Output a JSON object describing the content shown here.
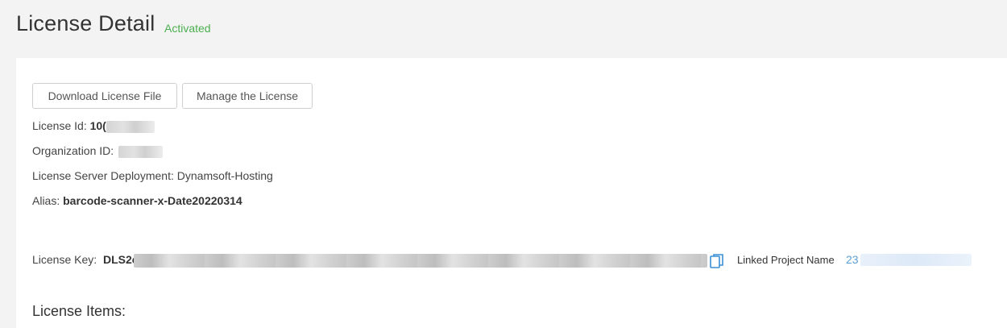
{
  "header": {
    "title": "License Detail",
    "status": "Activated"
  },
  "toolbar": {
    "download_label": "Download License File",
    "manage_label": "Manage the License"
  },
  "details": {
    "license_id_label": "License Id:",
    "license_id_value": "10(",
    "organization_id_label": "Organization ID:",
    "deployment_label": "License Server Deployment:",
    "deployment_value": "Dynamsoft-Hosting",
    "alias_label": "Alias:",
    "alias_value": "barcode-scanner-x-Date20220314"
  },
  "license_key": {
    "label": "License Key:",
    "value": "DLS2e",
    "copy_icon": "copy-icon",
    "linked_project_label": "Linked Project Name",
    "linked_project_value": "23"
  },
  "sections": {
    "license_items": "License Items:"
  },
  "colors": {
    "status": "#4caf50",
    "link": "#5aa0d8",
    "background": "#f3f3f3",
    "panel": "#ffffff"
  }
}
